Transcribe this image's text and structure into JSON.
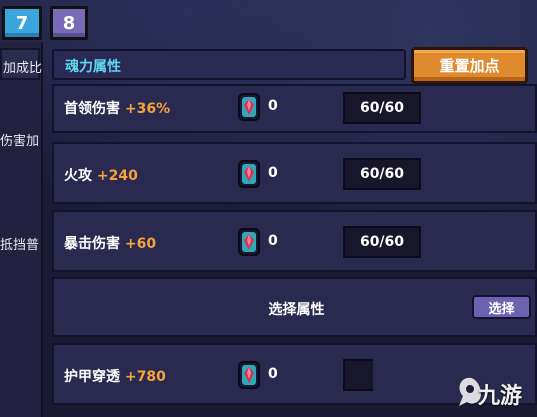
{
  "tabs": [
    {
      "label": "7",
      "active": true
    },
    {
      "label": "8",
      "active": false
    }
  ],
  "sidebar": {
    "items": [
      {
        "label": "伤害加成比!"
      },
      {
        "label": "伤害加"
      },
      {
        "label": "抵挡普"
      }
    ]
  },
  "header": {
    "title": "魂力属性",
    "reset_label": "重置加点"
  },
  "rows": [
    {
      "name": "首领伤害",
      "bonus": "+36%",
      "gem_icon": "soul-gem-icon",
      "gem_count": "0",
      "level": "60/60"
    },
    {
      "name": "火攻",
      "bonus": "+240",
      "gem_icon": "soul-gem-icon",
      "gem_count": "0",
      "level": "60/60"
    },
    {
      "name": "暴击伤害",
      "bonus": "+60",
      "gem_icon": "soul-gem-icon",
      "gem_count": "0",
      "level": "60/60"
    }
  ],
  "select_row": {
    "label": "选择属性",
    "button_label": "选择"
  },
  "partial_row": {
    "name": "护甲穿透",
    "bonus": "+780",
    "gem_count": "0"
  },
  "watermark": {
    "text": "九游"
  },
  "colors": {
    "title_cyan": "#5fd7ee",
    "bonus_orange": "#f7a23a",
    "reset_orange": "#e08a2e",
    "tab7_blue": "#3aa6dc",
    "tab8_purple": "#7a6bb8",
    "select_purple": "#6d62b0"
  }
}
